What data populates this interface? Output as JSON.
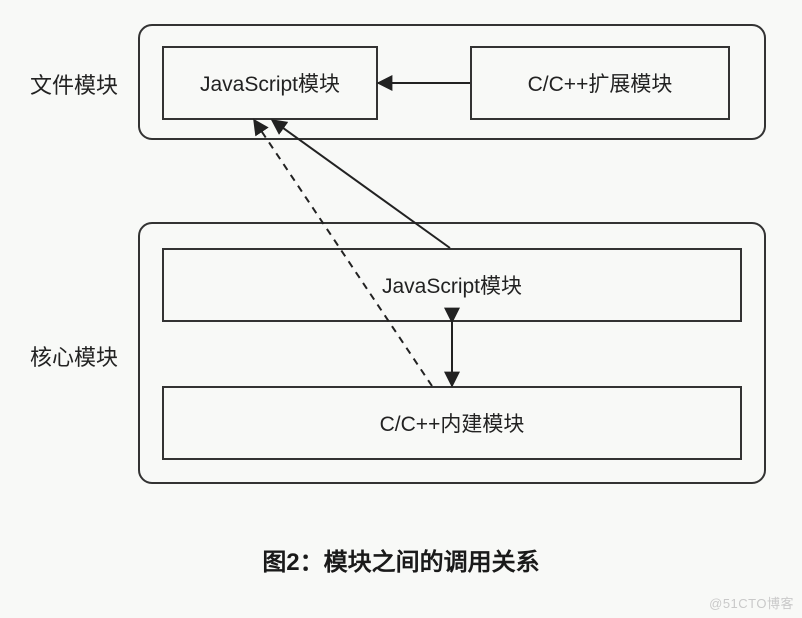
{
  "labels": {
    "file_module": "文件模块",
    "core_module": "核心模块"
  },
  "boxes": {
    "js_module_top": "JavaScript模块",
    "c_cpp_ext": "C/C++扩展模块",
    "js_module_core": "JavaScript模块",
    "c_cpp_builtin": "C/C++内建模块"
  },
  "caption": "图2：模块之间的调用关系",
  "watermark": "@51CTO博客",
  "chart_data": {
    "type": "diagram",
    "title": "图2：模块之间的调用关系",
    "groups": [
      {
        "name": "文件模块",
        "nodes": [
          "JavaScript模块",
          "C/C++扩展模块"
        ]
      },
      {
        "name": "核心模块",
        "nodes": [
          "JavaScript模块",
          "C/C++内建模块"
        ]
      }
    ],
    "edges": [
      {
        "from": "文件模块/C/C++扩展模块",
        "to": "文件模块/JavaScript模块",
        "style": "solid",
        "direction": "→"
      },
      {
        "from": "核心模块/JavaScript模块",
        "to": "文件模块/JavaScript模块",
        "style": "solid",
        "direction": "→"
      },
      {
        "from": "核心模块/C/C++内建模块",
        "to": "文件模块/JavaScript模块",
        "style": "dashed",
        "direction": "→"
      },
      {
        "from": "核心模块/JavaScript模块",
        "to": "核心模块/C/C++内建模块",
        "style": "solid",
        "direction": "↕"
      }
    ]
  }
}
